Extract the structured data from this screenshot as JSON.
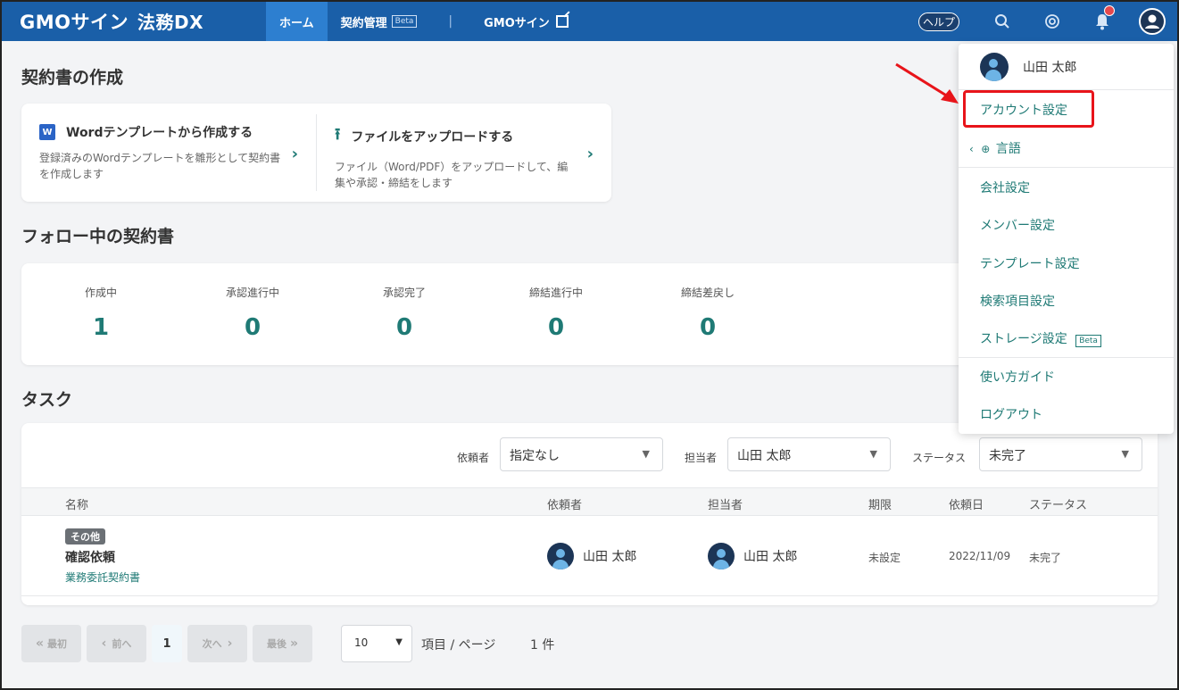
{
  "header": {
    "logo": "GMOサイン",
    "logo_suffix": "法務DX",
    "tabs": [
      {
        "label": "ホーム"
      },
      {
        "label": "契約管理",
        "badge": "Beta"
      },
      {
        "label": "GMOサイン"
      }
    ],
    "separator": "|",
    "help_label": "ヘルプ",
    "icons": [
      "search-icon",
      "at-icon",
      "bell-icon",
      "account-icon"
    ],
    "colors": {
      "header_bg": "#1a5fa8",
      "active_tab": "#2d7fd0",
      "accent": "#1f7a75"
    }
  },
  "create": {
    "title": "契約書の作成",
    "items": [
      {
        "title": "Wordテンプレートから作成する",
        "desc": "登録済みのWordテンプレートを雛形として契約書を作成します"
      },
      {
        "title": "ファイルをアップロードする",
        "desc": "ファイル（Word/PDF）をアップロードして、編集や承認・締結をします"
      }
    ]
  },
  "follow": {
    "title": "フォロー中の契約書",
    "stats": [
      {
        "label": "作成中",
        "value": "1"
      },
      {
        "label": "承認進行中",
        "value": "0"
      },
      {
        "label": "承認完了",
        "value": "0"
      },
      {
        "label": "締結進行中",
        "value": "0"
      },
      {
        "label": "締結差戻し",
        "value": "0"
      }
    ]
  },
  "tasks": {
    "title": "タスク",
    "filters": [
      {
        "label": "依頼者",
        "value": "指定なし"
      },
      {
        "label": "担当者",
        "value": "山田 太郎"
      },
      {
        "label": "ステータス",
        "value": "未完了"
      }
    ],
    "columns": [
      "名称",
      "依頼者",
      "担当者",
      "期限",
      "依頼日",
      "ステータス"
    ],
    "rows": [
      {
        "tag": "その他",
        "name": "確認依頼",
        "link": "業務委託契約書",
        "requester": "山田 太郎",
        "assignee": "山田 太郎",
        "deadline": "未設定",
        "date": "2022/11/09",
        "status": "未完了"
      }
    ]
  },
  "pagination": {
    "first": "最初",
    "prev": "前へ",
    "current": "1",
    "next": "次へ",
    "last": "最後",
    "per_page": "10",
    "per_page_label": "項目 / ページ",
    "total": "1 件"
  },
  "account_menu": {
    "user": "山田 太郎",
    "items": [
      {
        "label": "アカウント設定"
      },
      {
        "label": "言語"
      },
      {
        "label": "会社設定"
      },
      {
        "label": "メンバー設定"
      },
      {
        "label": "テンプレート設定"
      },
      {
        "label": "検索項目設定"
      },
      {
        "label": "ストレージ設定",
        "badge": "Beta"
      },
      {
        "label": "使い方ガイド"
      },
      {
        "label": "ログアウト"
      }
    ]
  }
}
